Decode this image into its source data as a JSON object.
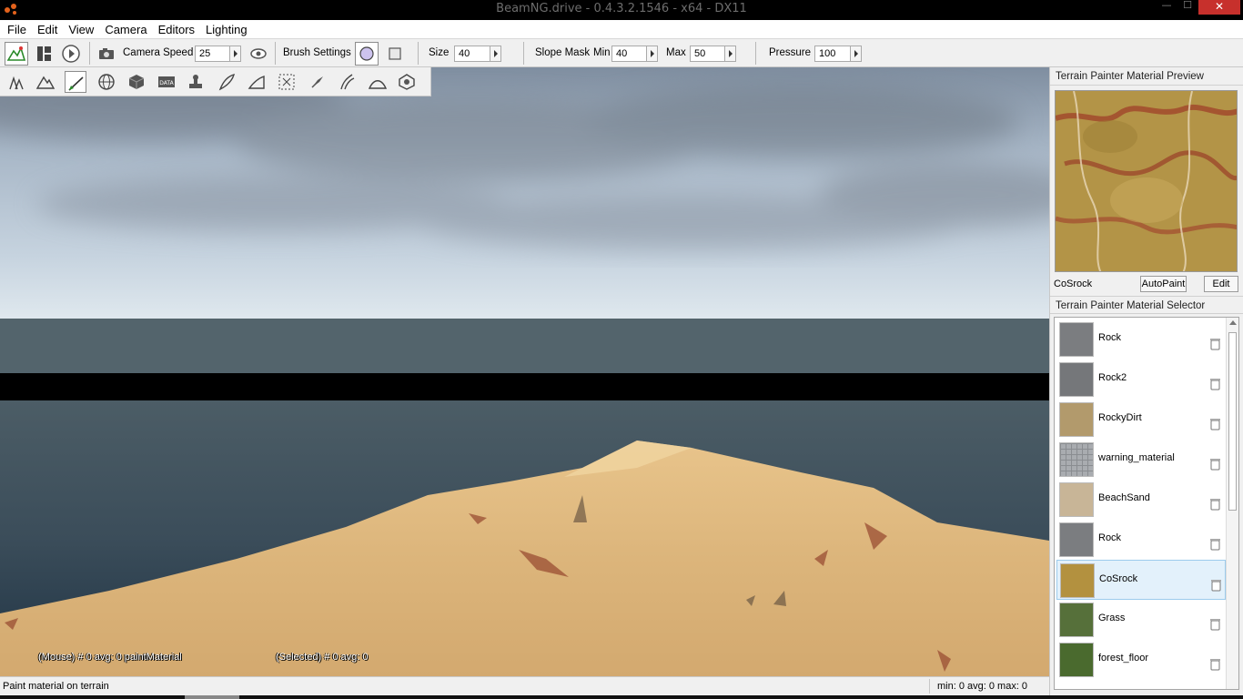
{
  "window": {
    "title": "BeamNG.drive - 0.4.3.2.1546 - x64 - DX11",
    "minimize": "—",
    "maximize": "☐",
    "close": "✕"
  },
  "menu": [
    "File",
    "Edit",
    "View",
    "Camera",
    "Editors",
    "Lighting"
  ],
  "toolbar": {
    "camera_speed_label": "Camera Speed",
    "camera_speed_value": "25",
    "brush_settings_label": "Brush Settings",
    "size_label": "Size",
    "size_value": "40",
    "slope_mask_label": "Slope Mask",
    "min_label": "Min",
    "min_value": "40",
    "max_label": "Max",
    "max_value": "50",
    "pressure_label": "Pressure",
    "pressure_value": "100"
  },
  "subtools": [
    "add-tree-icon",
    "terrain-icon",
    "paint-brush-icon",
    "globe-icon",
    "cube-icon",
    "data-icon",
    "stamp-icon",
    "feather-icon",
    "ramp-icon",
    "select-icon",
    "pin-icon",
    "road-icon",
    "hill-icon",
    "sphere-icon"
  ],
  "viewport": {
    "mouse_info": "(Mouse) # 0  avg: 0 paintMaterial",
    "selected_info": "(Selected) # 0  avg: 0"
  },
  "status": {
    "left": "Paint material on terrain",
    "right": "min: 0  avg: 0  max: 0"
  },
  "preview_panel": {
    "title": "Terrain Painter Material Preview",
    "material_name": "CoSrock",
    "autopaint_label": "AutoPaint",
    "edit_label": "Edit"
  },
  "selector_panel": {
    "title": "Terrain Painter Material Selector",
    "selected_index": 6,
    "items": [
      {
        "label": "Rock",
        "color": "#7b7d80"
      },
      {
        "label": "Rock2",
        "color": "#75777a"
      },
      {
        "label": "RockyDirt",
        "color": "#b29a6c"
      },
      {
        "label": "warning_material",
        "color": "#a9acb0"
      },
      {
        "label": "BeachSand",
        "color": "#c8b597"
      },
      {
        "label": "Rock",
        "color": "#7b7d80"
      },
      {
        "label": "CoSrock",
        "color": "#b3913f"
      },
      {
        "label": "Grass",
        "color": "#56703a"
      },
      {
        "label": "forest_floor",
        "color": "#4a6a2e"
      }
    ]
  }
}
